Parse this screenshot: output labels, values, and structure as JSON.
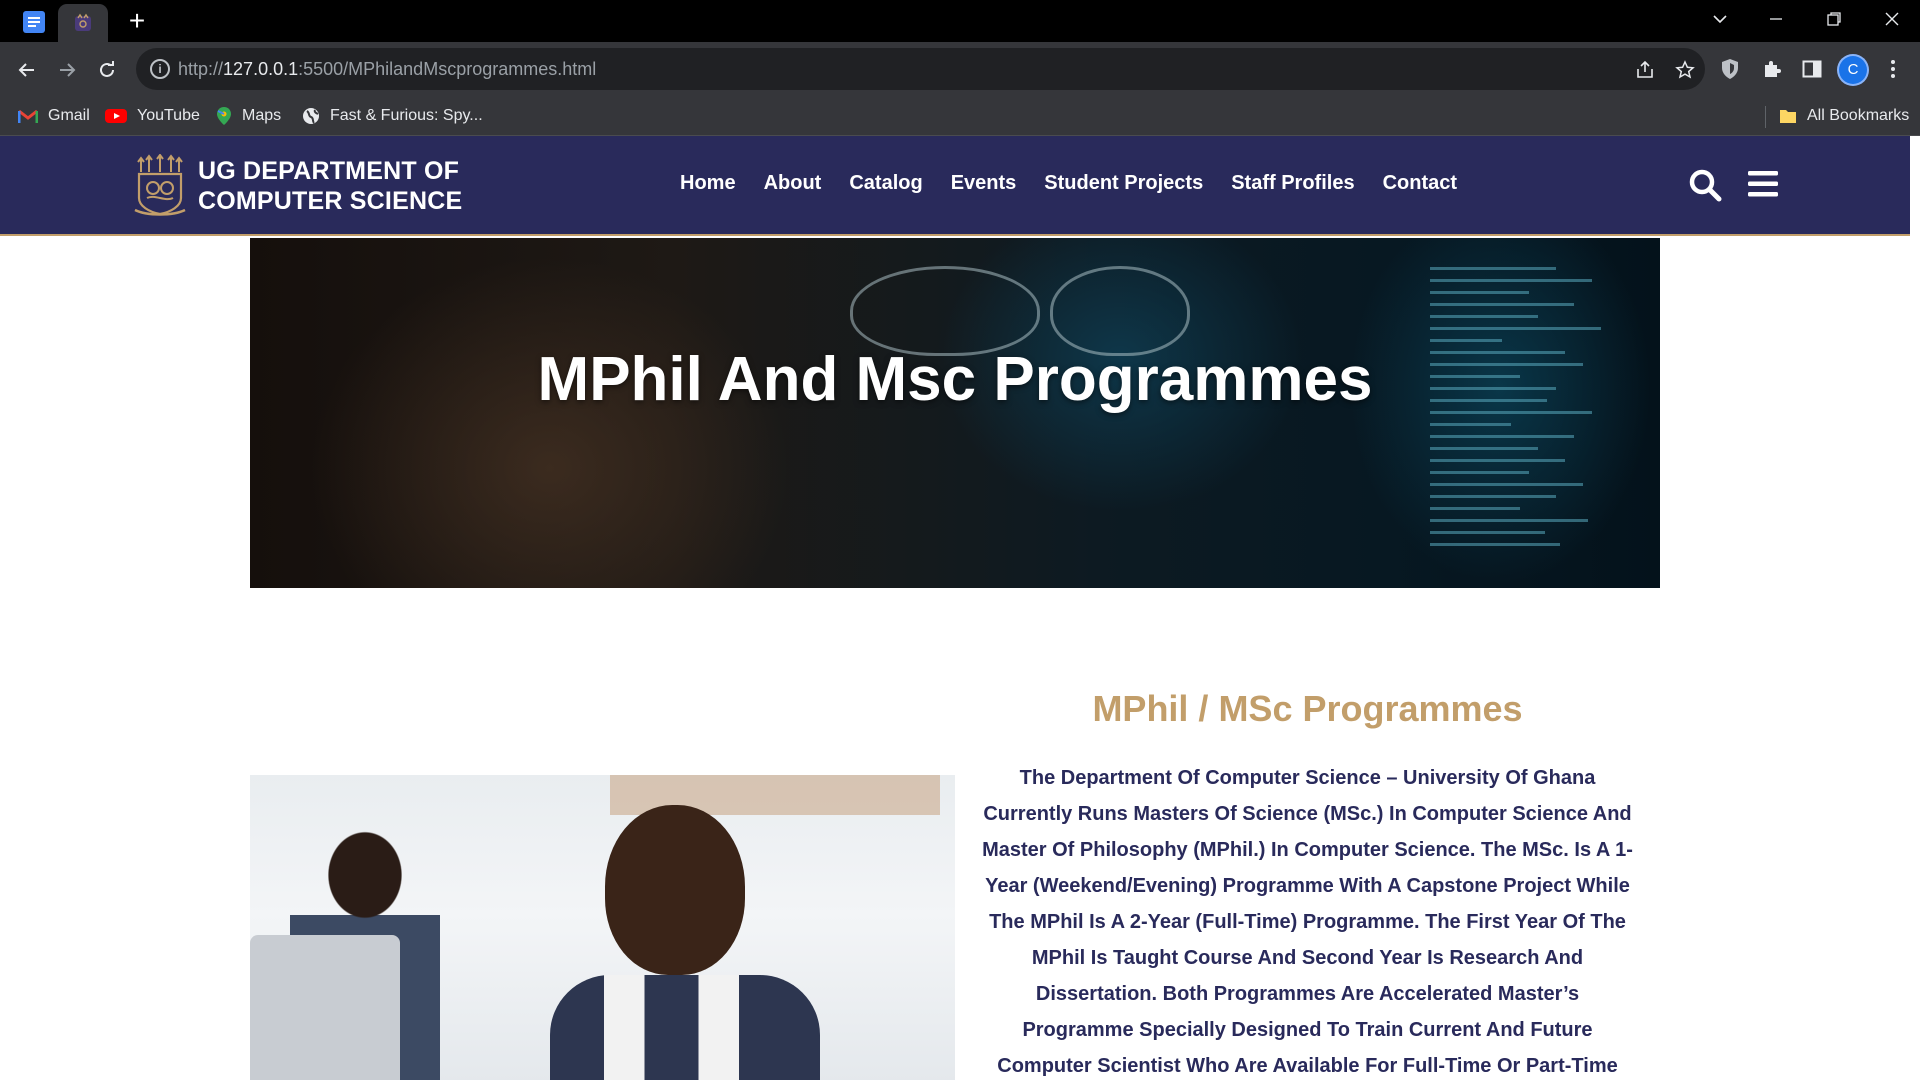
{
  "browser": {
    "tabs": [
      {
        "icon": "google-docs-icon",
        "pinned": true
      },
      {
        "icon": "ug-crest-favicon",
        "active": true
      }
    ],
    "new_tab_label": "+",
    "url": {
      "prefix": "http://",
      "host": "127.0.0.1",
      "rest": ":5500/MPhilandMscprogrammes.html"
    },
    "profile_initial": "C",
    "bookmarks": [
      {
        "label": "Gmail",
        "icon": "gmail-icon"
      },
      {
        "label": "YouTube",
        "icon": "youtube-icon"
      },
      {
        "label": "Maps",
        "icon": "maps-icon"
      },
      {
        "label": "Fast & Furious: Spy...",
        "icon": "globe-icon"
      }
    ],
    "all_bookmarks_label": "All Bookmarks"
  },
  "site": {
    "brand_line1": "UG DEPARTMENT OF",
    "brand_line2": "COMPUTER SCIENCE",
    "nav": [
      "Home",
      "About",
      "Catalog",
      "Events",
      "Student Projects",
      "Staff Profiles",
      "Contact"
    ],
    "hero_title": "MPhil And Msc Programmes",
    "section_title": "MPhil / MSc Programmes",
    "section_text": "The Department Of Computer Science – University Of Ghana Currently Runs Masters Of Science (MSc.) In Computer Science And Master Of Philosophy (MPhil.) In Computer Science. The MSc. Is A 1-Year (Weekend/Evening) Programme With A Capstone Project While The MPhil Is A 2-Year (Full-Time) Programme. The First Year Of The MPhil Is Taught Course And Second Year Is Research And Dissertation. Both Programmes Are Accelerated Master’s Programme Specially Designed To Train Current And Future Computer Scientist Who Are Available For Full-Time Or Part-Time Study. Students Enrolled In These Programmes",
    "colors": {
      "navbar": "#292a5b",
      "accent_gold": "#c29e6a",
      "body_text": "#292a5b"
    }
  }
}
